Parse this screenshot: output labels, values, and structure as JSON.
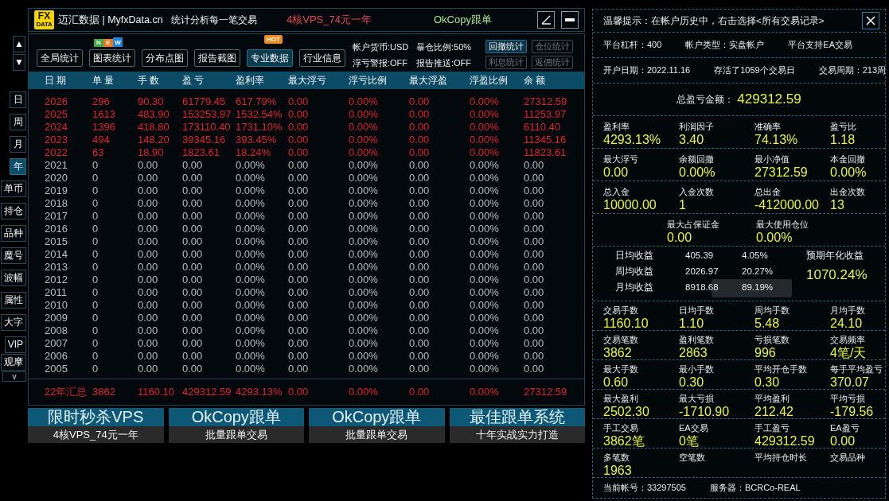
{
  "side_nav": {
    "scroll_buttons": [
      "▲",
      "▼"
    ],
    "tabs": [
      {
        "label": "日",
        "selected": false
      },
      {
        "label": "周",
        "selected": false
      },
      {
        "label": "月",
        "selected": false
      },
      {
        "label": "年",
        "selected": true
      },
      {
        "label": "单币",
        "selected": false
      },
      {
        "label": "持仓",
        "selected": false
      },
      {
        "label": "品种",
        "selected": false
      },
      {
        "label": "魔号",
        "selected": false
      },
      {
        "label": "波幅",
        "selected": false
      },
      {
        "label": "属性",
        "selected": false
      },
      {
        "label": "大字",
        "selected": false
      },
      {
        "label": "VIP",
        "selected": false
      },
      {
        "label": "观摩",
        "selected": false
      }
    ],
    "more_button": "v"
  },
  "window": {
    "logo": [
      "FX",
      "DATA"
    ],
    "title": "迈汇数据 | MyfxData.cn",
    "subtitle": "统计分析每一笔交易",
    "promos": [
      {
        "text": "4核VPS_74元一年",
        "color": "#e8445a"
      },
      {
        "text": "OkCopy跟单",
        "color": "#a6e58e"
      }
    ]
  },
  "toolbar": {
    "buttons": [
      {
        "label": "全局统计",
        "selected": false
      },
      {
        "label": "图表统计",
        "selected": false,
        "badge": {
          "kind": "letters",
          "letters": [
            {
              "text": "N",
              "color": "#3da846"
            },
            {
              "text": "E",
              "color": "#f07818"
            },
            {
              "text": "W",
              "color": "#1f86e0"
            }
          ]
        }
      },
      {
        "label": "分布点图",
        "selected": false
      },
      {
        "label": "报告截图",
        "selected": false
      },
      {
        "label": "专业数据",
        "selected": true,
        "badge": {
          "kind": "hot",
          "text": "HOT"
        }
      },
      {
        "label": "行业信息",
        "selected": false
      }
    ],
    "info": [
      "帐户货币:USD",
      "暴仓比例:50%",
      "浮亏警报:OFF",
      "报告推送:OFF"
    ],
    "stat_buttons": [
      {
        "label": "回撤统计",
        "disabled": false
      },
      {
        "label": "仓位统计",
        "disabled": true
      },
      {
        "label": "利息统计",
        "disabled": true
      },
      {
        "label": "返佣统计",
        "disabled": true
      }
    ]
  },
  "table": {
    "columns": [
      "日 期",
      "单 量",
      "手 数",
      "盈 亏",
      "盈利率",
      "最大浮亏",
      "浮亏比例",
      "最大浮盈",
      "浮盈比例",
      "余 额"
    ],
    "rows": [
      {
        "color": "#e3212c",
        "cells": [
          "2026",
          "296",
          "90.30",
          "61779.45",
          "617.79%",
          "0.00",
          "0.00%",
          "0.00",
          "0.00%",
          "27312.59"
        ]
      },
      {
        "color": "#e3212c",
        "cells": [
          "2025",
          "1613",
          "483.90",
          "153253.97",
          "1532.54%",
          "0.00",
          "0.00%",
          "0.00",
          "0.00%",
          "11253.97"
        ]
      },
      {
        "color": "#e3212c",
        "cells": [
          "2024",
          "1396",
          "418.80",
          "173110.40",
          "1731.10%",
          "0.00",
          "0.00%",
          "0.00",
          "0.00%",
          "6110.40"
        ]
      },
      {
        "color": "#e3212c",
        "cells": [
          "2023",
          "494",
          "148.20",
          "39345.16",
          "393.45%",
          "0.00",
          "0.00%",
          "0.00",
          "0.00%",
          "11345.16"
        ]
      },
      {
        "color": "#e3212c",
        "cells": [
          "2022",
          "63",
          "18.90",
          "1823.61",
          "18.24%",
          "0.00",
          "0.00%",
          "0.00",
          "0.00%",
          "11823.61"
        ]
      },
      {
        "color": "#bdbdbd",
        "cells": [
          "2021",
          "0",
          "0.00",
          "0.00",
          "0.00%",
          "0.00",
          "0.00%",
          "0.00",
          "0.00%",
          "0.00"
        ]
      },
      {
        "color": "#bdbdbd",
        "cells": [
          "2020",
          "0",
          "0.00",
          "0.00",
          "0.00%",
          "0.00",
          "0.00%",
          "0.00",
          "0.00%",
          "0.00"
        ]
      },
      {
        "color": "#bdbdbd",
        "cells": [
          "2019",
          "0",
          "0.00",
          "0.00",
          "0.00%",
          "0.00",
          "0.00%",
          "0.00",
          "0.00%",
          "0.00"
        ]
      },
      {
        "color": "#bdbdbd",
        "cells": [
          "2018",
          "0",
          "0.00",
          "0.00",
          "0.00%",
          "0.00",
          "0.00%",
          "0.00",
          "0.00%",
          "0.00"
        ]
      },
      {
        "color": "#bdbdbd",
        "cells": [
          "2017",
          "0",
          "0.00",
          "0.00",
          "0.00%",
          "0.00",
          "0.00%",
          "0.00",
          "0.00%",
          "0.00"
        ]
      },
      {
        "color": "#bdbdbd",
        "cells": [
          "2016",
          "0",
          "0.00",
          "0.00",
          "0.00%",
          "0.00",
          "0.00%",
          "0.00",
          "0.00%",
          "0.00"
        ]
      },
      {
        "color": "#bdbdbd",
        "cells": [
          "2015",
          "0",
          "0.00",
          "0.00",
          "0.00%",
          "0.00",
          "0.00%",
          "0.00",
          "0.00%",
          "0.00"
        ]
      },
      {
        "color": "#bdbdbd",
        "cells": [
          "2014",
          "0",
          "0.00",
          "0.00",
          "0.00%",
          "0.00",
          "0.00%",
          "0.00",
          "0.00%",
          "0.00"
        ]
      },
      {
        "color": "#bdbdbd",
        "cells": [
          "2013",
          "0",
          "0.00",
          "0.00",
          "0.00%",
          "0.00",
          "0.00%",
          "0.00",
          "0.00%",
          "0.00"
        ]
      },
      {
        "color": "#bdbdbd",
        "cells": [
          "2012",
          "0",
          "0.00",
          "0.00",
          "0.00%",
          "0.00",
          "0.00%",
          "0.00",
          "0.00%",
          "0.00"
        ]
      },
      {
        "color": "#bdbdbd",
        "cells": [
          "2011",
          "0",
          "0.00",
          "0.00",
          "0.00%",
          "0.00",
          "0.00%",
          "0.00",
          "0.00%",
          "0.00"
        ]
      },
      {
        "color": "#bdbdbd",
        "cells": [
          "2010",
          "0",
          "0.00",
          "0.00",
          "0.00%",
          "0.00",
          "0.00%",
          "0.00",
          "0.00%",
          "0.00"
        ]
      },
      {
        "color": "#bdbdbd",
        "cells": [
          "2009",
          "0",
          "0.00",
          "0.00",
          "0.00%",
          "0.00",
          "0.00%",
          "0.00",
          "0.00%",
          "0.00"
        ]
      },
      {
        "color": "#bdbdbd",
        "cells": [
          "2008",
          "0",
          "0.00",
          "0.00",
          "0.00%",
          "0.00",
          "0.00%",
          "0.00",
          "0.00%",
          "0.00"
        ]
      },
      {
        "color": "#bdbdbd",
        "cells": [
          "2007",
          "0",
          "0.00",
          "0.00",
          "0.00%",
          "0.00",
          "0.00%",
          "0.00",
          "0.00%",
          "0.00"
        ]
      },
      {
        "color": "#bdbdbd",
        "cells": [
          "2006",
          "0",
          "0.00",
          "0.00",
          "0.00%",
          "0.00",
          "0.00%",
          "0.00",
          "0.00%",
          "0.00"
        ]
      },
      {
        "color": "#bdbdbd",
        "cells": [
          "2005",
          "0",
          "0.00",
          "0.00",
          "0.00%",
          "0.00",
          "0.00%",
          "0.00",
          "0.00%",
          "0.00"
        ]
      }
    ],
    "summary": [
      "22年汇总",
      "3862",
      "1160.10",
      "429312.59",
      "4293.13%",
      "0.00",
      "0.00%",
      "0.00",
      "0.00%",
      "27312.59"
    ]
  },
  "banners": [
    {
      "title": "限时秒杀VPS",
      "subtitle": "4核VPS_74元一年"
    },
    {
      "title": "OkCopy跟单",
      "subtitle": "批量跟单交易"
    },
    {
      "title": "OkCopy跟单",
      "subtitle": "批量跟单交易"
    },
    {
      "title": "最佳跟单系统",
      "subtitle": "十年实战实力打造"
    }
  ],
  "account_panel": {
    "tip": "温馨提示：在帐户历史中，右击选择<所有交易记录>",
    "sections": [
      {
        "kind": "line",
        "texts": [
          "平台杠杆：400",
          "帐户类型：实盘帐户",
          "平台支持EA交易"
        ]
      },
      {
        "kind": "line",
        "texts": [
          "开户日期：2022.11.16",
          "存活了1059个交易日",
          "交易周期：213周"
        ]
      },
      {
        "kind": "total",
        "label": "总盈亏金额：",
        "value": "429312.59"
      },
      {
        "kind": "grid",
        "items": [
          {
            "label": "盈利率",
            "value": "4293.13%"
          },
          {
            "label": "利润因子",
            "value": "3.40"
          },
          {
            "label": "准确率",
            "value": "74.13%"
          },
          {
            "label": "盈亏比",
            "value": "1.18"
          }
        ]
      },
      {
        "kind": "grid",
        "items": [
          {
            "label": "最大浮亏",
            "value": "0.00"
          },
          {
            "label": "余额回撤",
            "value": "0.00%"
          },
          {
            "label": "最小净值",
            "value": "27312.59"
          },
          {
            "label": "本金回撤",
            "value": "0.00%"
          }
        ]
      },
      {
        "kind": "grid",
        "items": [
          {
            "label": "总入金",
            "value": "10000.00"
          },
          {
            "label": "入金次数",
            "value": "1"
          },
          {
            "label": "总出金",
            "value": "-412000.00"
          },
          {
            "label": "出金次数",
            "value": "13"
          }
        ]
      },
      {
        "kind": "pair",
        "items": [
          {
            "label": "最大占保证金",
            "value": "0.00"
          },
          {
            "label": "最大使用仓位",
            "value": "0.00%"
          }
        ]
      },
      {
        "kind": "averages",
        "rows": [
          {
            "label": "日均收益",
            "amount": "405.39",
            "percent": "4.05%"
          },
          {
            "label": "周均收益",
            "amount": "2026.97",
            "percent": "20.27%"
          },
          {
            "label": "月均收益",
            "amount": "8918.68",
            "percent": "89.19%"
          }
        ],
        "forecast": {
          "label": "预期年化收益",
          "value": "1070.24%"
        }
      },
      {
        "kind": "grid",
        "items": [
          {
            "label": "交易手数",
            "value": "1160.10"
          },
          {
            "label": "日均手数",
            "value": "1.10"
          },
          {
            "label": "周均手数",
            "value": "5.48"
          },
          {
            "label": "月均手数",
            "value": "24.10"
          }
        ]
      },
      {
        "kind": "grid",
        "items": [
          {
            "label": "交易笔数",
            "value": "3862"
          },
          {
            "label": "盈利笔数",
            "value": "2863"
          },
          {
            "label": "亏损笔数",
            "value": "996"
          },
          {
            "label": "交易频率",
            "value": "4笔/天"
          }
        ]
      },
      {
        "kind": "grid",
        "items": [
          {
            "label": "最大手数",
            "value": "0.60"
          },
          {
            "label": "最小手数",
            "value": "0.30"
          },
          {
            "label": "平均开仓手数",
            "value": "0.30"
          },
          {
            "label": "每手平均盈亏",
            "value": "370.07"
          }
        ]
      },
      {
        "kind": "grid",
        "items": [
          {
            "label": "最大盈利",
            "value": "2502.30"
          },
          {
            "label": "最大亏损",
            "value": "-1710.90"
          },
          {
            "label": "平均盈利",
            "value": "212.42"
          },
          {
            "label": "平均亏损",
            "value": "-179.56"
          }
        ]
      },
      {
        "kind": "grid",
        "items": [
          {
            "label": "手工交易",
            "value": "3862笔"
          },
          {
            "label": "EA交易",
            "value": "0笔"
          },
          {
            "label": "手工盈亏",
            "value": "429312.59"
          },
          {
            "label": "EA盈亏",
            "value": "0.00"
          }
        ]
      },
      {
        "kind": "grid",
        "items": [
          {
            "label": "多笔数",
            "value": "1963"
          },
          {
            "label": "空笔数"
          },
          {
            "label": "平均持仓时长"
          },
          {
            "label": "交易品种"
          }
        ]
      },
      {
        "kind": "line",
        "texts": [
          "当前帐号：33297505",
          "服务器：BCRCo-REAL"
        ]
      }
    ]
  }
}
